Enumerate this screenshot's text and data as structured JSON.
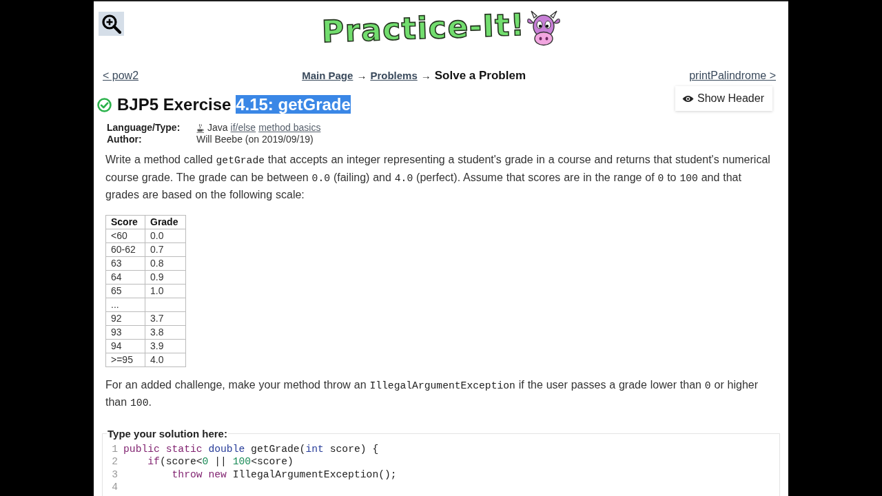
{
  "logo": {
    "text": "Practice-It!"
  },
  "nav": {
    "previous": "< pow2",
    "breadcrumb": [
      {
        "text": "Main Page",
        "kind": "link"
      },
      {
        "text": "→",
        "kind": "separator"
      },
      {
        "text": "Problems",
        "kind": "link"
      },
      {
        "text": "→",
        "kind": "separator"
      },
      {
        "text": "Solve a Problem",
        "kind": "current"
      }
    ],
    "next": "printPalindrome >"
  },
  "title": {
    "solved": true,
    "segments": [
      {
        "text": "BJP5 Exercise",
        "selected": false
      },
      {
        "text": "4.15: getGrade",
        "selected": true
      }
    ]
  },
  "show_header_button": "Show Header",
  "meta": [
    {
      "label": "Language/Type:",
      "parts": [
        {
          "text": "Java",
          "kind": "language"
        },
        {
          "text": "if/else",
          "kind": "link"
        },
        {
          "text": "method basics",
          "kind": "link"
        }
      ]
    },
    {
      "label": "Author:",
      "parts": [
        {
          "text": "Will Beebe (on 2019/09/19)",
          "kind": "text"
        }
      ]
    }
  ],
  "intro": [
    {
      "text": "Write a method called ",
      "kind": "text"
    },
    {
      "text": "getGrade",
      "kind": "code"
    },
    {
      "text": " that accepts an integer representing a student's grade in a course and returns that student's numerical course grade. The grade can be between ",
      "kind": "text"
    },
    {
      "text": "0.0",
      "kind": "code"
    },
    {
      "text": " (failing) and ",
      "kind": "text"
    },
    {
      "text": "4.0",
      "kind": "code"
    },
    {
      "text": " (perfect). Assume that scores are in the range of ",
      "kind": "text"
    },
    {
      "text": "0",
      "kind": "code"
    },
    {
      "text": " to ",
      "kind": "text"
    },
    {
      "text": "100",
      "kind": "code"
    },
    {
      "text": " and that grades are based on the following scale:",
      "kind": "text"
    }
  ],
  "scale_table": {
    "columns": [
      "Score",
      "Grade"
    ],
    "rows": [
      [
        "<60",
        "0.0"
      ],
      [
        "60-62",
        "0.7"
      ],
      [
        "63",
        "0.8"
      ],
      [
        "64",
        "0.9"
      ],
      [
        "65",
        "1.0"
      ],
      [
        "..."
      ],
      [
        "92",
        "3.7"
      ],
      [
        "93",
        "3.8"
      ],
      [
        "94",
        "3.9"
      ],
      [
        ">=95",
        "4.0"
      ]
    ]
  },
  "challenge": [
    {
      "text": "For an added challenge, make your method throw an ",
      "kind": "text"
    },
    {
      "text": "IllegalArgumentException",
      "kind": "code"
    },
    {
      "text": " if the user passes a grade lower than ",
      "kind": "text"
    },
    {
      "text": "0",
      "kind": "code"
    },
    {
      "text": " or higher than ",
      "kind": "text"
    },
    {
      "text": "100",
      "kind": "code"
    },
    {
      "text": ".",
      "kind": "text"
    }
  ],
  "solution": {
    "legend": "Type your solution here:",
    "lines": [
      {
        "number": "1",
        "tokens": [
          {
            "text": "public",
            "kind": "keyword"
          },
          {
            "text": " static",
            "kind": "keyword"
          },
          {
            "text": " double",
            "kind": "type"
          },
          {
            "text": " getGrade(",
            "kind": "plain"
          },
          {
            "text": "int",
            "kind": "type"
          },
          {
            "text": " score) {",
            "kind": "plain"
          }
        ]
      },
      {
        "number": "2",
        "tokens": [
          {
            "text": "    if",
            "kind": "keyword"
          },
          {
            "text": "(score<",
            "kind": "plain"
          },
          {
            "text": "0",
            "kind": "number"
          },
          {
            "text": " || ",
            "kind": "plain"
          },
          {
            "text": "100",
            "kind": "number"
          },
          {
            "text": "<score)",
            "kind": "plain"
          }
        ]
      },
      {
        "number": "3",
        "tokens": [
          {
            "text": "        throw new",
            "kind": "keyword"
          },
          {
            "text": " IllegalArgumentException();",
            "kind": "plain"
          }
        ]
      },
      {
        "number": "4"
      }
    ]
  }
}
